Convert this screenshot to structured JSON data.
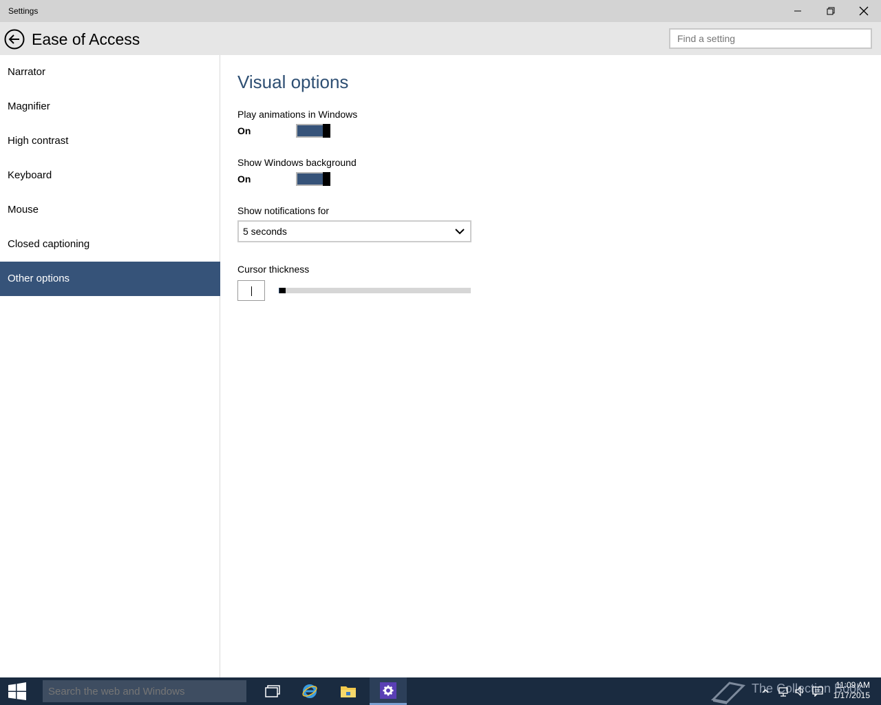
{
  "window": {
    "title": "Settings"
  },
  "header": {
    "page_title": "Ease of Access",
    "search_placeholder": "Find a setting"
  },
  "sidebar": {
    "items": [
      {
        "label": "Narrator"
      },
      {
        "label": "Magnifier"
      },
      {
        "label": "High contrast"
      },
      {
        "label": "Keyboard"
      },
      {
        "label": "Mouse"
      },
      {
        "label": "Closed captioning"
      },
      {
        "label": "Other options",
        "selected": true
      }
    ]
  },
  "main": {
    "section_title": "Visual options",
    "animations": {
      "label": "Play animations in Windows",
      "state": "On",
      "on": true
    },
    "background": {
      "label": "Show Windows background",
      "state": "On",
      "on": true
    },
    "notifications": {
      "label": "Show notifications for",
      "value": "5 seconds"
    },
    "cursor": {
      "label": "Cursor thickness",
      "level": 0.0
    }
  },
  "taskbar": {
    "search_placeholder": "Search the web and Windows",
    "watermark": "The Collection Book",
    "time": "11:09 AM",
    "date": "1/17/2015",
    "apps": [
      "task-view-icon",
      "internet-explorer-icon",
      "file-explorer-icon",
      "settings-gear-icon"
    ]
  },
  "colors": {
    "accent": "#365379",
    "heading": "#2e4f73",
    "taskbar": "#1a2b40"
  }
}
